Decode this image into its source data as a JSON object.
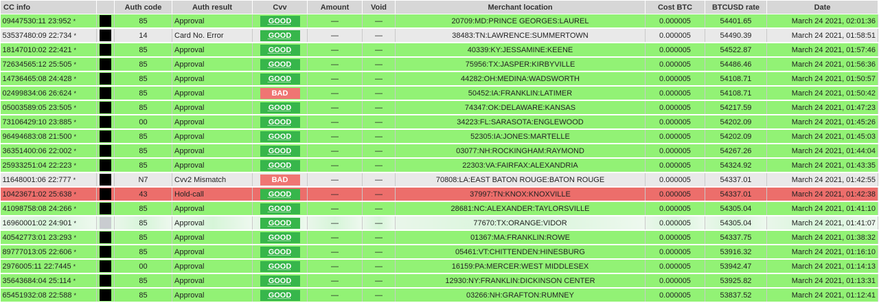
{
  "headers": [
    "CC info",
    "",
    "Auth code",
    "Auth result",
    "Cvv",
    "Amount",
    "Void",
    "Merchant location",
    "Cost BTC",
    "BTCUSD rate",
    "Date"
  ],
  "rows": [
    {
      "cc": "09447530:11 23:952",
      "star": "*",
      "flag": "dark",
      "auth_code": "85",
      "auth_result": "Approval",
      "cvv": "GOOD",
      "amount": "—",
      "void": "—",
      "location": "20709:MD:PRINCE GEORGES:LAUREL",
      "cost": "0.000005",
      "rate": "54401.65",
      "date": "March 24 2021, 02:01:36",
      "status": "green"
    },
    {
      "cc": "53537480:09 22:734",
      "star": "*",
      "flag": "dark",
      "auth_code": "14",
      "auth_result": "Card No. Error",
      "cvv": "GOOD",
      "amount": "—",
      "void": "—",
      "location": "38483:TN:LAWRENCE:SUMMERTOWN",
      "cost": "0.000005",
      "rate": "54490.39",
      "date": "March 24 2021, 01:58:51",
      "status": "gray"
    },
    {
      "cc": "18147010:02 22:421",
      "star": "*",
      "flag": "dark",
      "auth_code": "85",
      "auth_result": "Approval",
      "cvv": "GOOD",
      "amount": "—",
      "void": "—",
      "location": "40339:KY:JESSAMINE:KEENE",
      "cost": "0.000005",
      "rate": "54522.87",
      "date": "March 24 2021, 01:57:46",
      "status": "green"
    },
    {
      "cc": "72634565:12 25:505",
      "star": "*",
      "flag": "dark",
      "auth_code": "85",
      "auth_result": "Approval",
      "cvv": "GOOD",
      "amount": "—",
      "void": "—",
      "location": "75956:TX:JASPER:KIRBYVILLE",
      "cost": "0.000005",
      "rate": "54486.46",
      "date": "March 24 2021, 01:56:36",
      "status": "green"
    },
    {
      "cc": "14736465:08 24:428",
      "star": "*",
      "flag": "dark",
      "auth_code": "85",
      "auth_result": "Approval",
      "cvv": "GOOD",
      "amount": "—",
      "void": "—",
      "location": "44282:OH:MEDINA:WADSWORTH",
      "cost": "0.000005",
      "rate": "54108.71",
      "date": "March 24 2021, 01:50:57",
      "status": "green"
    },
    {
      "cc": "02499834:06 26:624",
      "star": "*",
      "flag": "dark",
      "auth_code": "85",
      "auth_result": "Approval",
      "cvv": "BAD",
      "amount": "—",
      "void": "—",
      "location": "50452:IA:FRANKLIN:LATIMER",
      "cost": "0.000005",
      "rate": "54108.71",
      "date": "March 24 2021, 01:50:42",
      "status": "green"
    },
    {
      "cc": "05003589:05 23:505",
      "star": "*",
      "flag": "dark",
      "auth_code": "85",
      "auth_result": "Approval",
      "cvv": "GOOD",
      "amount": "—",
      "void": "—",
      "location": "74347:OK:DELAWARE:KANSAS",
      "cost": "0.000005",
      "rate": "54217.59",
      "date": "March 24 2021, 01:47:23",
      "status": "green"
    },
    {
      "cc": "73106429:10 23:885",
      "star": "*",
      "flag": "dark",
      "auth_code": "00",
      "auth_result": "Approval",
      "cvv": "GOOD",
      "amount": "—",
      "void": "—",
      "location": "34223:FL:SARASOTA:ENGLEWOOD",
      "cost": "0.000005",
      "rate": "54202.09",
      "date": "March 24 2021, 01:45:26",
      "status": "green"
    },
    {
      "cc": "96494683:08 21:500",
      "star": "*",
      "flag": "dark",
      "auth_code": "85",
      "auth_result": "Approval",
      "cvv": "GOOD",
      "amount": "—",
      "void": "—",
      "location": "52305:IA:JONES:MARTELLE",
      "cost": "0.000005",
      "rate": "54202.09",
      "date": "March 24 2021, 01:45:03",
      "status": "green"
    },
    {
      "cc": "36351400:06 22:002",
      "star": "*",
      "flag": "dark",
      "auth_code": "85",
      "auth_result": "Approval",
      "cvv": "GOOD",
      "amount": "—",
      "void": "—",
      "location": "03077:NH:ROCKINGHAM:RAYMOND",
      "cost": "0.000005",
      "rate": "54267.26",
      "date": "March 24 2021, 01:44:04",
      "status": "green"
    },
    {
      "cc": "25933251:04 22:223",
      "star": "*",
      "flag": "dark",
      "auth_code": "85",
      "auth_result": "Approval",
      "cvv": "GOOD",
      "amount": "—",
      "void": "—",
      "location": "22303:VA:FAIRFAX:ALEXANDRIA",
      "cost": "0.000005",
      "rate": "54324.92",
      "date": "March 24 2021, 01:43:35",
      "status": "green"
    },
    {
      "cc": "11648001:06 22:777",
      "star": "*",
      "flag": "dark",
      "auth_code": "N7",
      "auth_result": "Cvv2 Mismatch",
      "cvv": "BAD",
      "amount": "—",
      "void": "—",
      "location": "70808:LA:EAST BATON ROUGE:BATON ROUGE",
      "cost": "0.000005",
      "rate": "54337.01",
      "date": "March 24 2021, 01:42:55",
      "status": "gray"
    },
    {
      "cc": "10423671:02 25:638",
      "star": "*",
      "flag": "dark",
      "auth_code": "43",
      "auth_result": "Hold-call",
      "cvv": "GOOD",
      "amount": "—",
      "void": "—",
      "location": "37997:TN:KNOX:KNOXVILLE",
      "cost": "0.000005",
      "rate": "54337.01",
      "date": "March 24 2021, 01:42:38",
      "status": "red"
    },
    {
      "cc": "41098758:08 24:266",
      "star": "*",
      "flag": "dark",
      "auth_code": "85",
      "auth_result": "Approval",
      "cvv": "GOOD",
      "amount": "—",
      "void": "—",
      "location": "28681:NC:ALEXANDER:TAYLORSVILLE",
      "cost": "0.000005",
      "rate": "54305.04",
      "date": "March 24 2021, 01:41:10",
      "status": "green"
    },
    {
      "cc": "16960001:02 24:901",
      "star": "*",
      "flag": "light",
      "auth_code": "85",
      "auth_result": "Approval",
      "cvv": "GOOD",
      "amount": "—",
      "void": "—",
      "location": "77670:TX:ORANGE:VIDOR",
      "cost": "0.000005",
      "rate": "54305.04",
      "date": "March 24 2021, 01:41:07",
      "status": "light"
    },
    {
      "cc": "40542773:01 23:293",
      "star": "*",
      "flag": "dark",
      "auth_code": "85",
      "auth_result": "Approval",
      "cvv": "GOOD",
      "amount": "—",
      "void": "—",
      "location": "01367:MA:FRANKLIN:ROWE",
      "cost": "0.000005",
      "rate": "54337.75",
      "date": "March 24 2021, 01:38:32",
      "status": "green"
    },
    {
      "cc": "89777013:05 22:606",
      "star": "*",
      "flag": "dark",
      "auth_code": "85",
      "auth_result": "Approval",
      "cvv": "GOOD",
      "amount": "—",
      "void": "—",
      "location": "05461:VT:CHITTENDEN:HINESBURG",
      "cost": "0.000005",
      "rate": "53916.32",
      "date": "March 24 2021, 01:16:10",
      "status": "green"
    },
    {
      "cc": "2976005:11 22:7445",
      "star": "*",
      "flag": "dark",
      "auth_code": "00",
      "auth_result": "Approval",
      "cvv": "GOOD",
      "amount": "—",
      "void": "—",
      "location": "16159:PA:MERCER:WEST MIDDLESEX",
      "cost": "0.000005",
      "rate": "53942.47",
      "date": "March 24 2021, 01:14:13",
      "status": "green"
    },
    {
      "cc": "35643684:04 25:114",
      "star": "*",
      "flag": "dark",
      "auth_code": "85",
      "auth_result": "Approval",
      "cvv": "GOOD",
      "amount": "—",
      "void": "—",
      "location": "12930:NY:FRANKLIN:DICKINSON CENTER",
      "cost": "0.000005",
      "rate": "53925.82",
      "date": "March 24 2021, 01:13:31",
      "status": "green"
    },
    {
      "cc": "65451932:08 22:588",
      "star": "*",
      "flag": "dark",
      "auth_code": "85",
      "auth_result": "Approval",
      "cvv": "GOOD",
      "amount": "—",
      "void": "—",
      "location": "03266:NH:GRAFTON:RUMNEY",
      "cost": "0.000005",
      "rate": "53837.52",
      "date": "March 24 2021, 01:12:41",
      "status": "green"
    }
  ],
  "colors": {
    "green_row": "#92f275",
    "gray_row": "#e9e9e9",
    "red_row": "#ec6e6b",
    "cvv_good": "#37b64b",
    "cvv_bad": "#ef7573"
  }
}
